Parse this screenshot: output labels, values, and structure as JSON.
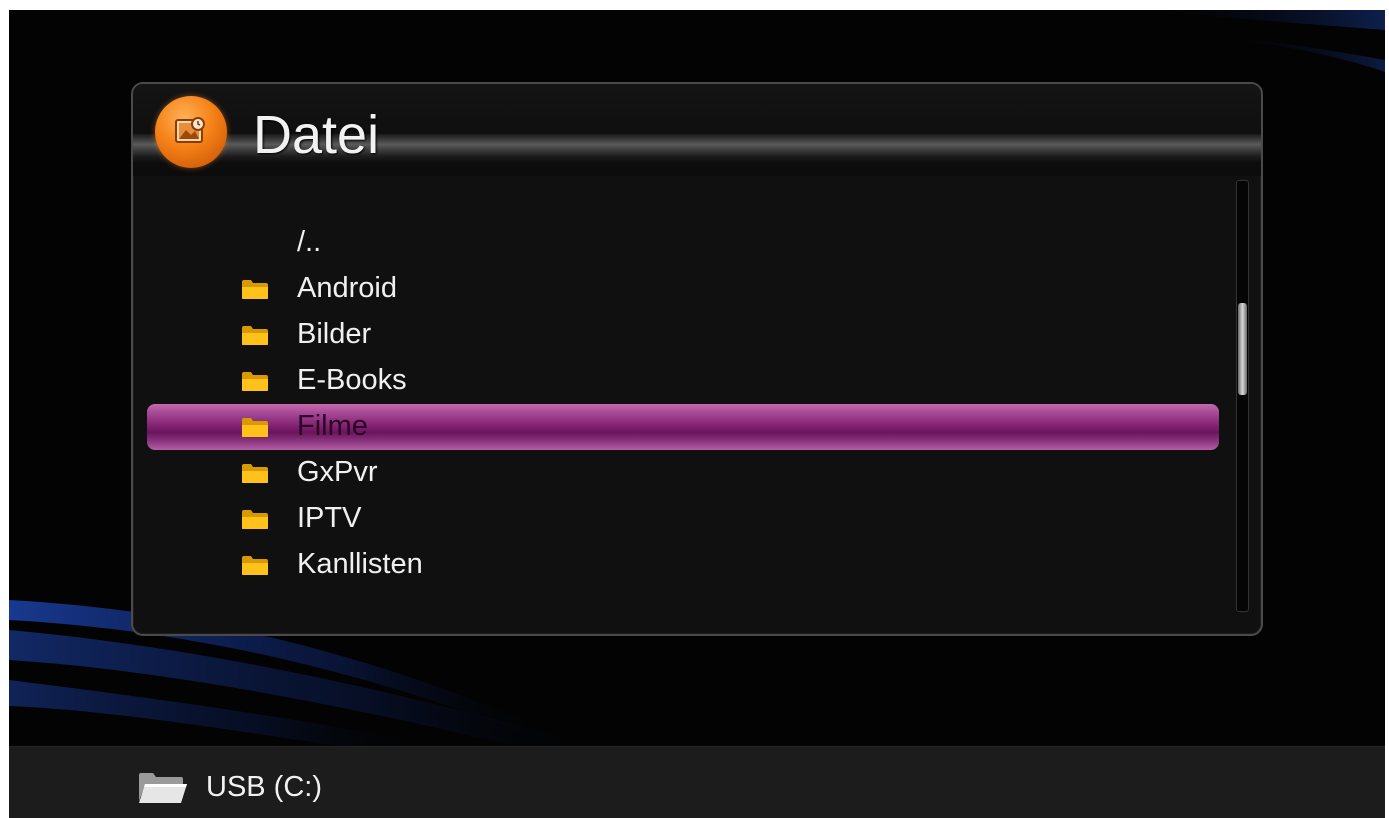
{
  "panel": {
    "title": "Datei",
    "title_icon": "picture-icon"
  },
  "file_list": [
    {
      "name": "/..",
      "icon": "none"
    },
    {
      "name": "Android",
      "icon": "folder-icon"
    },
    {
      "name": "Bilder",
      "icon": "folder-icon"
    },
    {
      "name": "E-Books",
      "icon": "folder-icon"
    },
    {
      "name": "Filme",
      "icon": "folder-icon",
      "selected": true
    },
    {
      "name": "GxPvr",
      "icon": "folder-icon"
    },
    {
      "name": "IPTV",
      "icon": "folder-icon"
    },
    {
      "name": "Kanllisten",
      "icon": "folder-icon"
    }
  ],
  "status_bar": {
    "drive_label": "USB (C:)",
    "drive_icon": "open-folder-icon"
  },
  "colors": {
    "selection": "#8c2a7a",
    "header_icon": "#f58016",
    "folder": "#f5b400",
    "background": "#030303"
  },
  "scroll": {
    "position_fraction": 0.3
  }
}
